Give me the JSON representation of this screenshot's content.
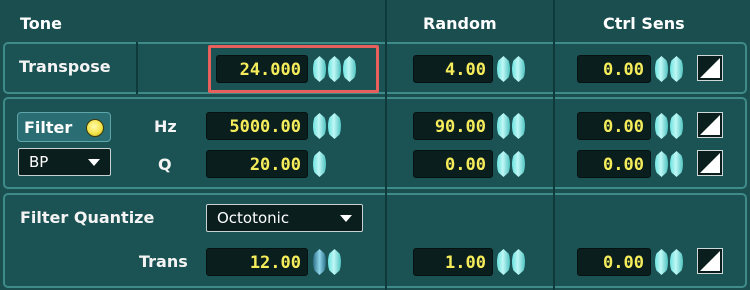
{
  "headers": {
    "tone": "Tone",
    "random": "Random",
    "ctrl_sens": "Ctrl Sens"
  },
  "transpose": {
    "label": "Transpose",
    "value": "24.000",
    "random": "4.00",
    "ctrl_sens": "0.00"
  },
  "filter": {
    "button_label": "Filter",
    "type_selected": "BP",
    "hz_label": "Hz",
    "hz_value": "5000.00",
    "hz_random": "90.00",
    "hz_ctrl_sens": "0.00",
    "q_label": "Q",
    "q_value": "20.00",
    "q_random": "0.00",
    "q_ctrl_sens": "0.00"
  },
  "quantize": {
    "label": "Filter Quantize",
    "mode_selected": "Octotonic",
    "trans_label": "Trans",
    "trans_value": "12.00",
    "trans_random": "1.00",
    "trans_ctrl_sens": "0.00"
  },
  "colors": {
    "background": "#1a4e4f",
    "panel_border": "#3f8b8a",
    "value_text": "#f4ec5a",
    "highlight": "#e8605c",
    "led": "#f5e44a"
  },
  "icons": {
    "value_knob": "hexagon-knob-icon",
    "ctrl_curve": "linear-curve-icon",
    "dropdown": "chevron-down-icon",
    "led": "led-indicator-icon"
  }
}
